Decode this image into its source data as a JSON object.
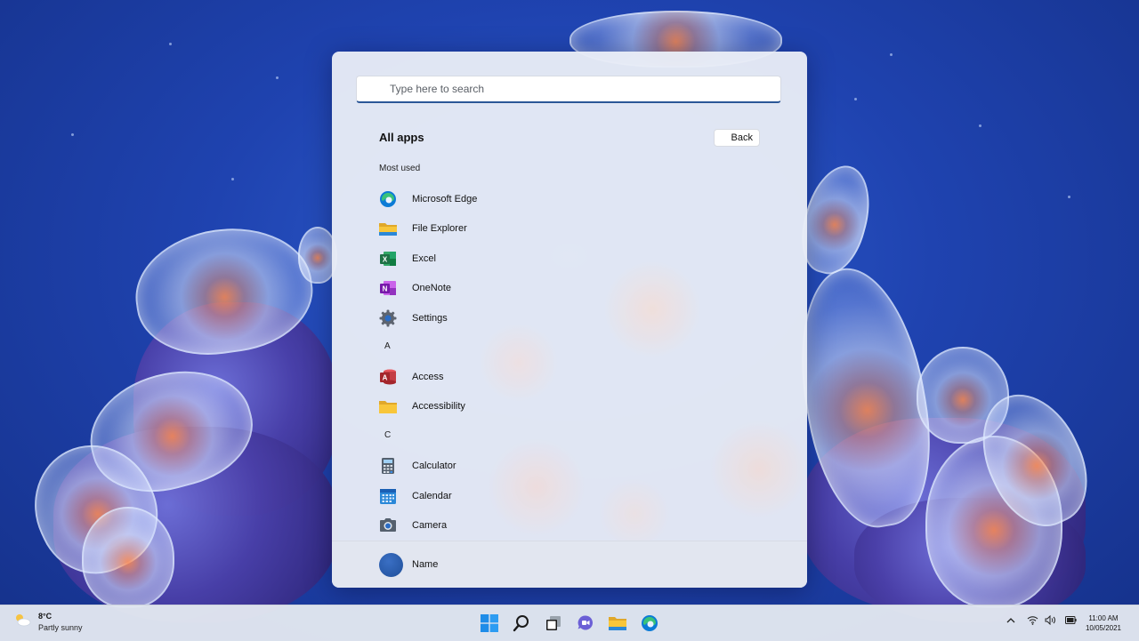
{
  "search": {
    "placeholder": "Type here to search"
  },
  "all_apps": {
    "title": "All apps",
    "back_label": "Back",
    "sections": [
      {
        "label": "Most used",
        "apps": [
          "Microsoft Edge",
          "File Explorer",
          "Excel",
          "OneNote",
          "Settings"
        ]
      },
      {
        "label": "A",
        "apps": [
          "Access",
          "Accessibility"
        ]
      },
      {
        "label": "C",
        "apps": [
          "Calculator",
          "Calendar",
          "Camera"
        ]
      }
    ]
  },
  "apps": {
    "edge": "Microsoft Edge",
    "explorer": "File Explorer",
    "excel": "Excel",
    "onenote": "OneNote",
    "settings": "Settings",
    "access": "Access",
    "accessibility": "Accessibility",
    "calculator": "Calculator",
    "calendar": "Calendar",
    "camera": "Camera"
  },
  "section_labels": {
    "most_used": "Most used",
    "a": "A",
    "c": "C"
  },
  "user": {
    "name": "Name"
  },
  "weather": {
    "temp": "8°C",
    "condition": "Partly sunny",
    "icon": "partly-sunny-icon"
  },
  "taskbar": {
    "pinned": [
      "start-icon",
      "search-icon",
      "task-view-icon",
      "chat-icon",
      "file-explorer-icon",
      "edge-icon"
    ]
  },
  "tray": {
    "icons": [
      "chevron-up-icon",
      "wifi-icon",
      "volume-icon",
      "battery-icon"
    ]
  },
  "clock": {
    "time": "11:00 AM",
    "date": "10/05/2021"
  },
  "colors": {
    "accent": "#2b5797",
    "edge_blue": "#0c7bd6",
    "excel_green": "#1e7145",
    "onenote_purple": "#7719aa",
    "access_red": "#a4262c",
    "folder_yellow": "#f8c63a"
  }
}
